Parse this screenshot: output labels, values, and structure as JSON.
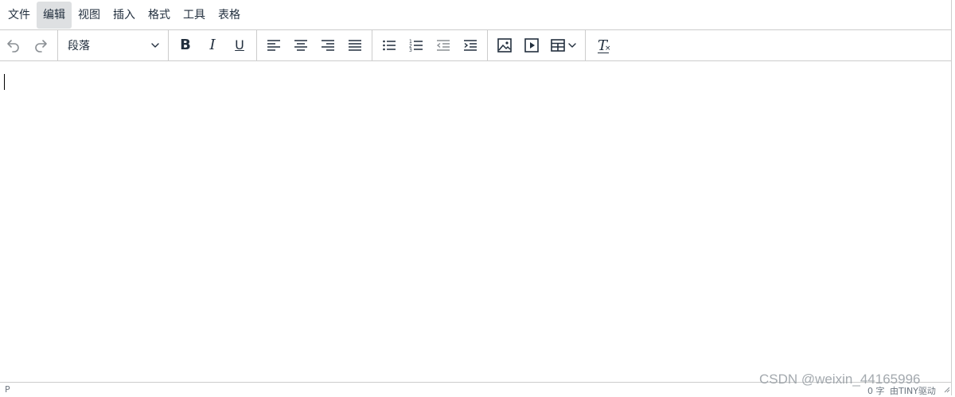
{
  "menubar": {
    "items": [
      "文件",
      "编辑",
      "视图",
      "插入",
      "格式",
      "工具",
      "表格"
    ],
    "active_index": 1
  },
  "toolbar": {
    "block_format": "段落",
    "buttons": {
      "undo": "undo-icon",
      "redo": "redo-icon",
      "bold": "B",
      "italic": "I",
      "underline": "U",
      "align_left": "align-left-icon",
      "align_center": "align-center-icon",
      "align_right": "align-right-icon",
      "justify": "justify-icon",
      "bullet_list": "bullet-list-icon",
      "numbered_list": "numbered-list-icon",
      "outdent": "outdent-icon",
      "indent": "indent-icon",
      "image": "image-icon",
      "media": "media-icon",
      "table": "table-icon",
      "clear_format": "T"
    }
  },
  "statusbar": {
    "path": "P",
    "word_count": "0 字",
    "branding": "由TINY驱动"
  },
  "watermark": "CSDN @weixin_44165996",
  "colors": {
    "text": "#222f3e",
    "border": "#cccccc",
    "active_menu_bg": "#dee0e2",
    "disabled_icon": "#8a8f94"
  }
}
